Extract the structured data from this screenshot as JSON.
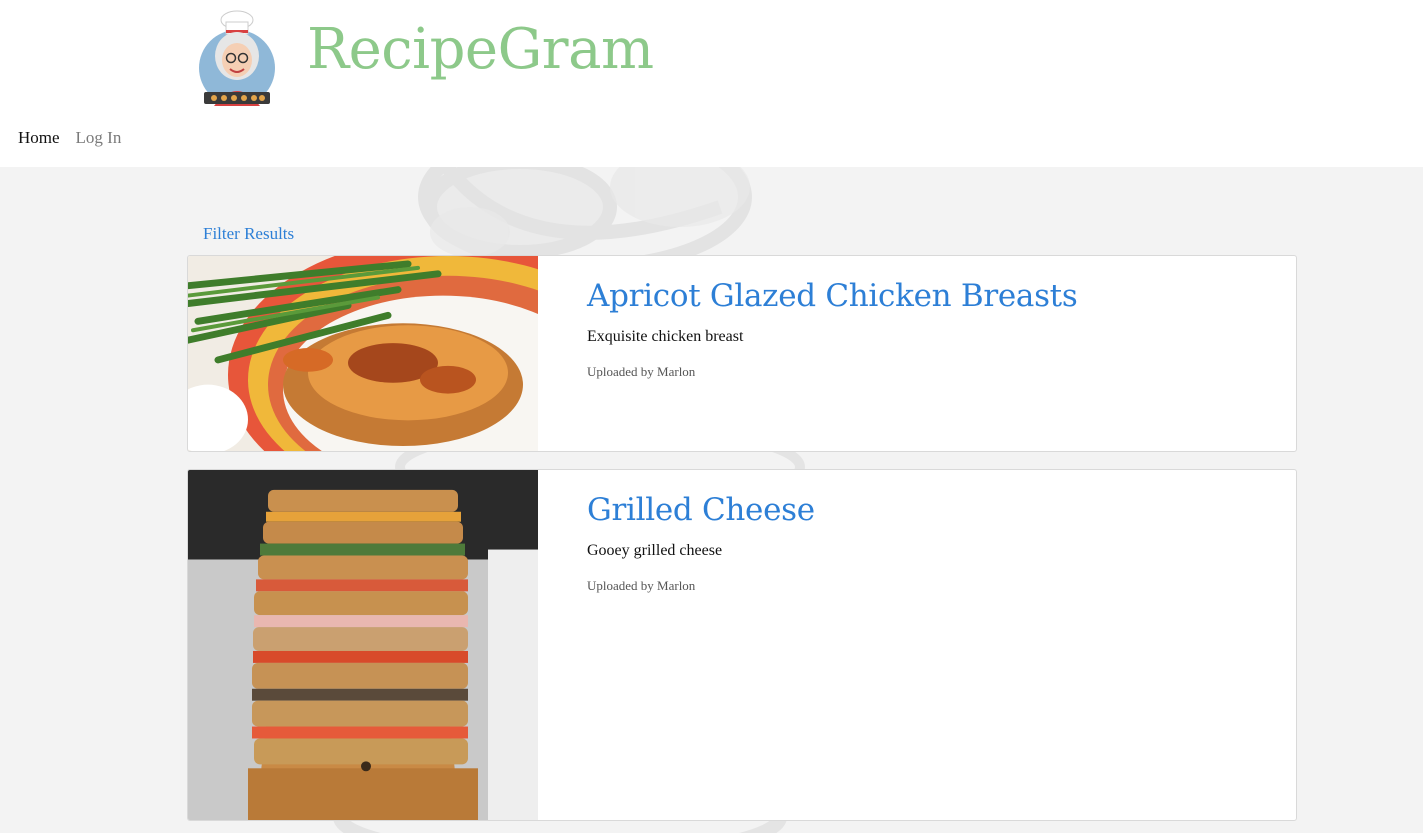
{
  "brand": {
    "name": "RecipeGram",
    "color": "#8dc98a"
  },
  "nav": {
    "home": "Home",
    "login": "Log In"
  },
  "filter": {
    "label": "Filter Results"
  },
  "recipes": [
    {
      "title": "Apricot Glazed Chicken Breasts",
      "description": "Exquisite chicken breast",
      "uploader": "Uploaded by Marlon",
      "image": "chicken-green-beans-photo"
    },
    {
      "title": "Grilled Cheese",
      "description": "Gooey grilled cheese",
      "uploader": "Uploaded by Marlon",
      "image": "stacked-grilled-cheese-photo"
    }
  ],
  "colors": {
    "link": "#2d7fd6",
    "background": "#f3f3f3"
  }
}
